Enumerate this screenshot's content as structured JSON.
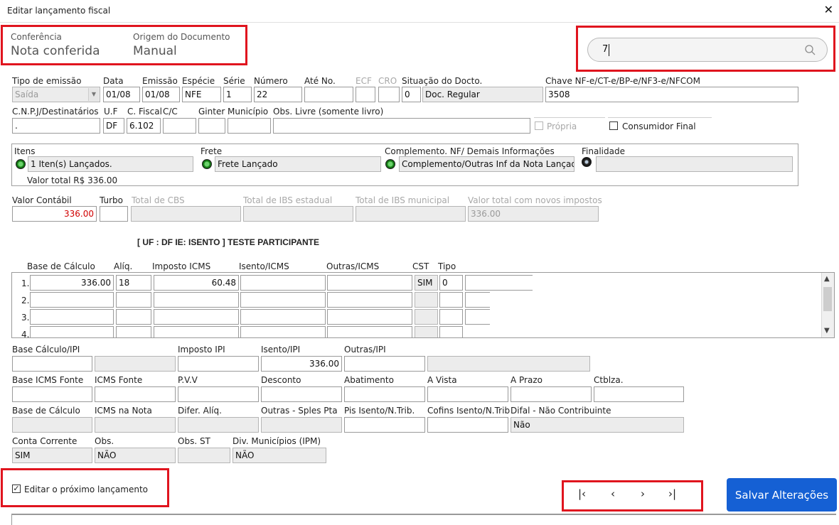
{
  "window": {
    "title": "Editar lançamento fiscal",
    "close_glyph": "✕"
  },
  "header": {
    "conferencia_label": "Conferência",
    "conferencia_value": "Nota conferida",
    "origem_label": "Origem do Documento",
    "origem_value": "Manual",
    "search_value": "7"
  },
  "row1": {
    "tipo_emissao_label": "Tipo de emissão",
    "tipo_emissao_value": "Saída",
    "data_label": "Data",
    "data_value": "01/08",
    "emissao_label": "Emissão",
    "emissao_value": "01/08",
    "especie_label": "Espécie",
    "especie_value": "NFE",
    "serie_label": "Série",
    "serie_value": "1",
    "numero_label": "Número",
    "numero_value": "22",
    "ate_no_label": "Até No.",
    "ate_no_value": "",
    "ecf_label": "ECF",
    "cro_label": "CRO",
    "situacao_label": "Situação do Docto.",
    "situacao_code": "0",
    "situacao_value": "Doc. Regular",
    "chave_label": "Chave NF-e/CT-e/BP-e/NF3-e/NFCOM",
    "chave_value": "3508"
  },
  "row2": {
    "cnpj_label": "C.N.P.J/Destinatários",
    "cnpj_value": ". ",
    "uf_label": "U.F",
    "uf_value": "DF",
    "cfiscal_label": "C. Fiscal",
    "cfiscal_value": "6.102",
    "cc_label": "C/C",
    "ginter_label": "Ginter",
    "municipio_label": "Município",
    "obs_livre_label": "Obs. Livre (somente livro)",
    "propria_label": "Própria",
    "consumidor_label": "Consumidor Final"
  },
  "status": {
    "itens_label": "Itens",
    "itens_value": "1 Iten(s) Lançados.",
    "valor_total": "Valor total R$ 336.00",
    "frete_label": "Frete",
    "frete_value": "Frete Lançado",
    "complemento_label": "Complemento. NF/ Demais Informações",
    "complemento_value": "Complemento/Outras Inf da Nota Lançad",
    "finalidade_label": "Finalidade",
    "finalidade_value": ""
  },
  "valores": {
    "valor_contabil_label": "Valor Contábil",
    "valor_contabil_value": "336.00",
    "turbo_label": "Turbo",
    "cbs_label": "Total de CBS",
    "ibs_est_label": "Total de IBS estadual",
    "ibs_mun_label": "Total de IBS municipal",
    "novos_label": "Valor total com novos impostos",
    "novos_value": "336.00"
  },
  "participante": "[ UF : DF IE: ISENTO ] TESTE PARTICIPANTE",
  "icms_grid": {
    "headers": [
      "Base de Cálculo",
      "Alíq.",
      "Imposto ICMS",
      "Isento/ICMS",
      "Outras/ICMS",
      "CST",
      "Tipo"
    ],
    "row_numbers": [
      "1.",
      "2.",
      "3.",
      "4."
    ],
    "row1": {
      "base": "336.00",
      "aliq": "18",
      "imposto": "60.48",
      "cst": "SIM",
      "tipo": "0"
    }
  },
  "ipi": {
    "base_ipi_label": "Base Cálculo/IPI",
    "imposto_ipi_label": "Imposto IPI",
    "isento_ipi_label": "Isento/IPI",
    "isento_ipi_value": "336.00",
    "outras_ipi_label": "Outras/IPI"
  },
  "row_fonte": {
    "base_icms_fonte": "Base ICMS Fonte",
    "icms_fonte": "ICMS Fonte",
    "pvv": "P.V.V",
    "desconto": "Desconto",
    "abatimento": "Abatimento",
    "a_vista": "A Vista",
    "a_prazo": "A Prazo",
    "ctblza": "Ctblza."
  },
  "row_base": {
    "base_calculo": "Base de Cálculo",
    "icms_nota": "ICMS na Nota",
    "difer_aliq": "Difer. Alíq.",
    "outras_spl": "Outras - Sples Pta",
    "pis_isento": "Pis Isento/N.Trib.",
    "cofins_isento": "Cofins Isento/N.Trib",
    "difal_label": "Difal - Não Contribuinte",
    "difal_value": "Não"
  },
  "row_conta": {
    "conta_label": "Conta Corrente",
    "conta_value": "SIM",
    "obs_label": "Obs.",
    "obs_value": "NÃO",
    "obs_st_label": "Obs. ST",
    "div_mun_label": "Div. Municípios (IPM)",
    "div_mun_value": "NÃO"
  },
  "footer": {
    "editar_proximo_label": "Editar o próximo lançamento",
    "first_glyph": "|‹",
    "prev_glyph": "‹",
    "next_glyph": "›",
    "last_glyph": "›|",
    "save_label": "Salvar Alterações"
  },
  "colors": {
    "highlight": "#e0141e",
    "primary": "#1560d4",
    "status_green": "#1c8a1c",
    "value_red": "#d00000"
  }
}
